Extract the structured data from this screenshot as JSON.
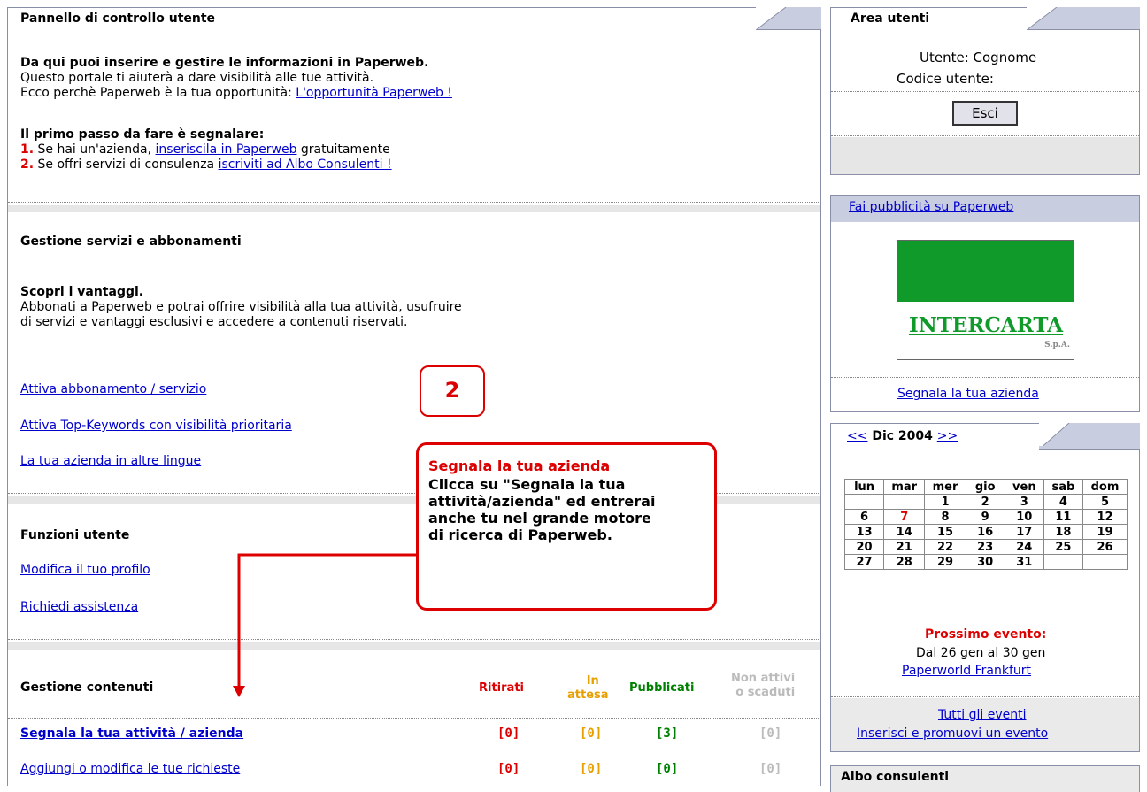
{
  "left": {
    "header": "Pannello di controllo utente",
    "intro": {
      "title": "Da qui puoi inserire e gestire le informazioni in Paperweb.",
      "line2": "Questo portale ti aiuterà a dare visibilità alle tue attività.",
      "line3_prefix": "Ecco perchè Paperweb è la tua opportunità: ",
      "line3_link": "L'opportunità Paperweb !"
    },
    "first_step": {
      "title": "Il primo passo da fare è segnalare:",
      "n1": "1.",
      "s1_prefix": " Se hai un'azienda, ",
      "s1_link": "inseriscila in Paperweb",
      "s1_suffix": " gratuitamente",
      "n2": "2.",
      "s2_prefix": " Se offri servizi di consulenza ",
      "s2_link": "iscriviti ad Albo Consulenti !"
    },
    "services": {
      "title": "Gestione servizi e abbonamenti",
      "subtitle": "Scopri i vantaggi.",
      "desc1": "Abbonati a Paperweb e potrai offrire visibilità alla tua attività, usufruire",
      "desc2": "di servizi e vantaggi esclusivi e accedere a contenuti riservati.",
      "links": [
        "Attiva abbonamento / servizio",
        "Attiva Top-Keywords con visibilità prioritaria",
        "La tua azienda in altre lingue"
      ]
    },
    "user_functions": {
      "title": "Funzioni utente",
      "links": [
        "Modifica il tuo profilo",
        "Richiedi assistenza"
      ]
    },
    "contents": {
      "title": "Gestione contenuti",
      "col_ritirati": "Ritirati",
      "col_attesa_1": "In",
      "col_attesa_2": "attesa",
      "col_pubblicati": "Pubblicati",
      "col_nonattivi_1": "Non attivi",
      "col_nonattivi_2": "o scaduti",
      "rows": [
        {
          "label": "Segnala la tua attività / azienda",
          "ritirati": "[0]",
          "attesa": "[0]",
          "pubblicati": "[3]",
          "nonattivi": "[0]"
        },
        {
          "label": "Aggiungi o modifica le tue richieste",
          "ritirati": "[0]",
          "attesa": "[0]",
          "pubblicati": "[0]",
          "nonattivi": "[0]"
        }
      ]
    }
  },
  "callout": {
    "step": "2",
    "title": "Segnala la tua azienda",
    "body1": "Clicca su \"Segnala la tua",
    "body2": "attività/azienda\" ed entrerai",
    "body3": "anche tu nel grande motore",
    "body4": "di ricerca di Paperweb."
  },
  "right": {
    "area": {
      "header": "Area utenti",
      "user": "Utente: Cognome",
      "code": "Codice utente:",
      "logout": "Esci"
    },
    "ads": {
      "header_link": "Fai pubblicità su Paperweb",
      "logo_text": "INTERCARTA",
      "logo_sub": "S.p.A.",
      "link": "Segnala la tua azienda"
    },
    "calendar": {
      "prev": "<<",
      "month": "Dic 2004",
      "next": ">>",
      "days": [
        "lun",
        "mar",
        "mer",
        "gio",
        "ven",
        "sab",
        "dom"
      ],
      "weeks": [
        [
          "",
          "",
          "1",
          "2",
          "3",
          "4",
          "5"
        ],
        [
          "6",
          "7",
          "8",
          "9",
          "10",
          "11",
          "12"
        ],
        [
          "13",
          "14",
          "15",
          "16",
          "17",
          "18",
          "19"
        ],
        [
          "20",
          "21",
          "22",
          "23",
          "24",
          "25",
          "26"
        ],
        [
          "27",
          "28",
          "29",
          "30",
          "31",
          "",
          ""
        ]
      ],
      "next_event_label": "Prossimo evento:",
      "next_event_dates": "Dal 26 gen al 30 gen",
      "next_event_link": "Paperworld Frankfurt",
      "all_events": "Tutti gli eventi",
      "promote_event": "Inserisci e promuovi un evento"
    },
    "albo": {
      "header": "Albo consulenti"
    }
  },
  "colors": {
    "accent_red": "#dd0000",
    "pending_orange": "#e8a000",
    "published_green": "#008000",
    "inactive_gray": "#bbbbbb",
    "header_blue": "#c9cde0",
    "logo_green": "#0f9a2a"
  }
}
